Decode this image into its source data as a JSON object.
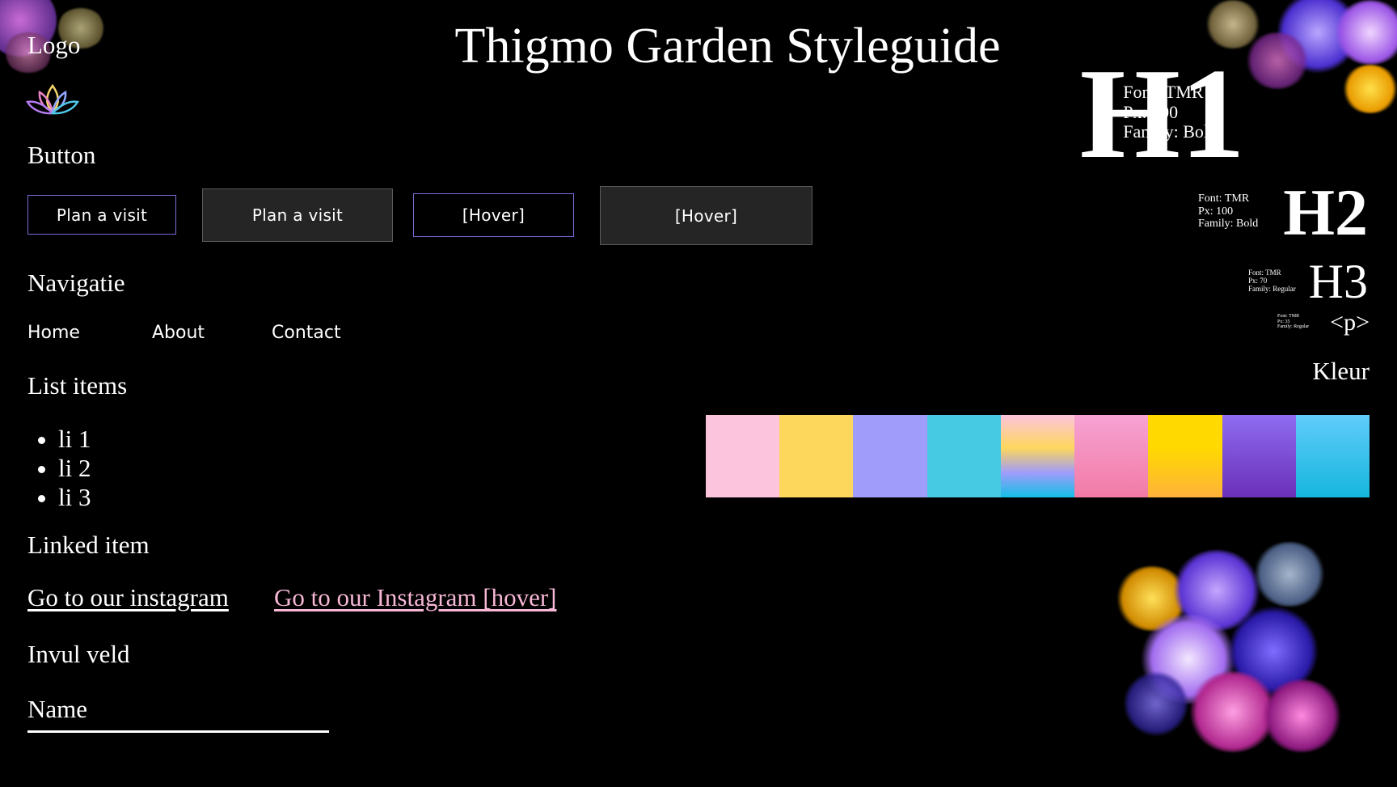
{
  "header": {
    "title": "Thigmo Garden Styleguide",
    "logo_label": "Logo"
  },
  "icons": {
    "logo": "lotus-icon"
  },
  "sections": {
    "button": "Button",
    "navigation": "Navigatie",
    "list": "List items",
    "linked": "Linked item",
    "input": "Invul veld"
  },
  "buttons": [
    {
      "label": "Plan a visit",
      "style": "outline"
    },
    {
      "label": "Plan a visit",
      "style": "filled"
    },
    {
      "label": "[Hover]",
      "style": "outline"
    },
    {
      "label": "[Hover]",
      "style": "filled"
    }
  ],
  "nav": [
    "Home",
    "About",
    "Contact"
  ],
  "list_items": [
    "li 1",
    "li 2",
    "li 3"
  ],
  "links": [
    {
      "label": "Go to our instagram",
      "color": "#ffffff"
    },
    {
      "label": "Go to our Instagram [hover]",
      "color": "#f7b7d6"
    }
  ],
  "input": {
    "label": "Name"
  },
  "typography": [
    {
      "tag": "H1",
      "font": "Font: TMR",
      "px": "Px: 200",
      "family": "Family: Bold"
    },
    {
      "tag": "H2",
      "font": "Font: TMR",
      "px": "Px: 100",
      "family": "Family: Bold"
    },
    {
      "tag": "H3",
      "font": "Font: TMR",
      "px": "Px: 70",
      "family": "Family: Regular"
    },
    {
      "tag": "<p>",
      "font": "Font: TMR",
      "px": "Px: 35",
      "family": "Family: Regular"
    }
  ],
  "colors": {
    "label": "Kleur",
    "swatches": [
      {
        "name": "pink",
        "fill": "#fdc4dd"
      },
      {
        "name": "yellow",
        "fill": "#fdd75c"
      },
      {
        "name": "lavender",
        "fill": "#9f9cfa"
      },
      {
        "name": "cyan",
        "fill": "#46c9e2"
      },
      {
        "name": "gradient-yellow-blue",
        "fill": "linear-gradient(#fdc4dd 0%, #fdd75c 40%, #9f9cfa 70%, #13c0e7 100%)"
      },
      {
        "name": "gradient-pink",
        "fill": "linear-gradient(#f6a3d4, #f27aa5)"
      },
      {
        "name": "gradient-gold",
        "fill": "linear-gradient(#ffd900 40%, #ffb23a)"
      },
      {
        "name": "gradient-purple",
        "fill": "linear-gradient(#8e6cf1, #6b2fb8)"
      },
      {
        "name": "gradient-sky",
        "fill": "linear-gradient(#60ccfb, #16b6dd)"
      }
    ]
  }
}
